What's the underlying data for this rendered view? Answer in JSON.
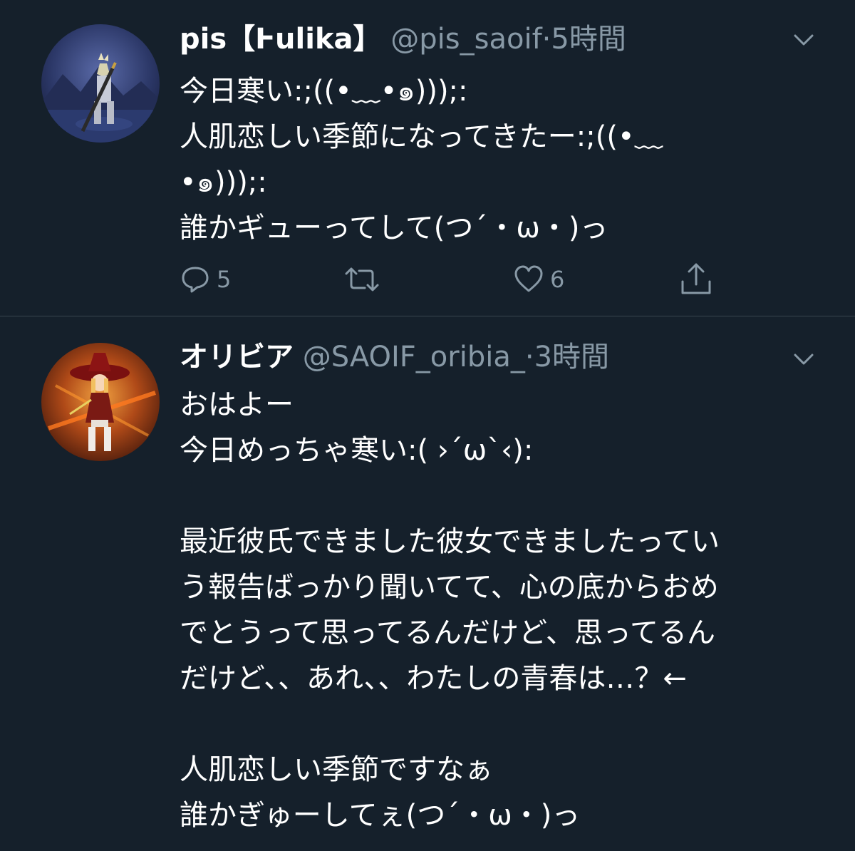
{
  "tweets": [
    {
      "display_name": "pis【Ⱶulika】",
      "handle": "@pis_saoif",
      "separator": "·",
      "time": "5時間",
      "text_lines": [
        "今日寒い:;((•﹏•๑)));:",
        "人肌恋しい季節になってきたー:;((•﹏",
        "•๑)));:",
        "誰かギューってして(つ´・ω・)っ"
      ],
      "reply_count": "5",
      "retweet_count": "",
      "like_count": "6",
      "avatar_icon": "avatar-knight-icon"
    },
    {
      "display_name": "オリビア",
      "handle": "@SAOIF_oribia_",
      "separator": "·",
      "time": "3時間",
      "text_lines": [
        "おはよー",
        "今日めっちゃ寒い:( ›´ω`‹):",
        "",
        "最近彼氏できました彼女できましたってい",
        "う報告ばっかり聞いてて、心の底からおめ",
        "でとうって思ってるんだけど、思ってるん",
        "だけど、、あれ、、わたしの青春は…？←",
        "",
        "人肌恋しい季節ですなぁ",
        "誰かぎゅーしてぇ(つ´・ω・)っ"
      ],
      "avatar_icon": "avatar-witch-icon"
    }
  ],
  "colors": {
    "background": "#15202b",
    "primary_text": "#ffffff",
    "secondary_text": "#8899a6",
    "divider": "#38444d"
  }
}
